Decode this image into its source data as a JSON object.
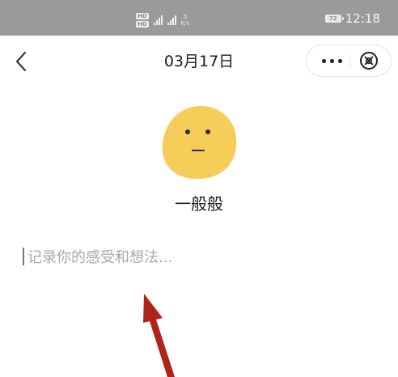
{
  "status_bar": {
    "hd_top": "HD",
    "hd_bottom": "HD",
    "network_speed_value": "5",
    "network_speed_unit": "K/s",
    "battery": "72",
    "time": "12:18"
  },
  "header": {
    "title": "03月17日",
    "back_icon": "chevron-left-icon",
    "more_icon": "more-dots-icon",
    "close_icon": "close-circle-icon"
  },
  "mood": {
    "label": "一般般",
    "face_icon": "neutral-face-icon",
    "face_color": "#F7CD5A"
  },
  "note": {
    "placeholder": "记录你的感受和想法..."
  },
  "annotation": {
    "arrow_color": "#B0221A"
  }
}
